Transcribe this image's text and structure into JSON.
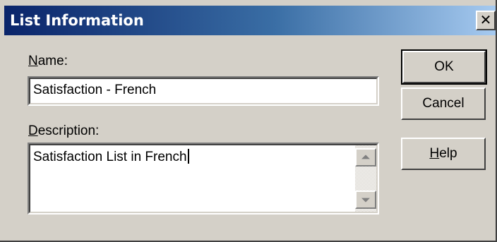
{
  "window": {
    "title": "List Information",
    "close_glyph": "✕"
  },
  "name_field": {
    "label_mnemonic": "N",
    "label_rest": "ame:",
    "value": "Satisfaction - French"
  },
  "description_field": {
    "label_mnemonic": "D",
    "label_rest": "escription:",
    "value": "Satisfaction List in French"
  },
  "buttons": {
    "ok": "OK",
    "cancel": "Cancel",
    "help_mnemonic": "H",
    "help_rest": "elp"
  },
  "colors": {
    "face": "#d4d0c8",
    "title_start": "#0a246a",
    "title_end": "#a6caf0"
  }
}
